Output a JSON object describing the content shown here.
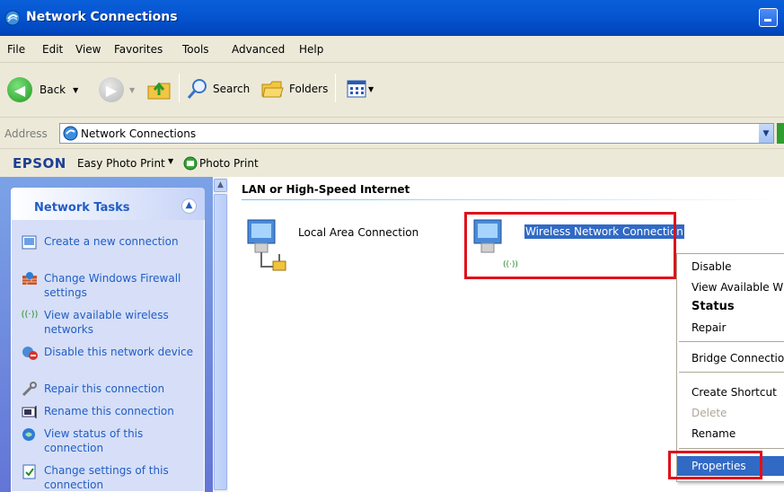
{
  "window": {
    "title": "Network Connections"
  },
  "menu": [
    "File",
    "Edit",
    "View",
    "Favorites",
    "Tools",
    "Advanced",
    "Help"
  ],
  "toolbar": {
    "back": "Back",
    "search": "Search",
    "folders": "Folders"
  },
  "address": {
    "label": "Address",
    "value": "Network Connections"
  },
  "epson": {
    "logo": "EPSON",
    "easy_photo": "Easy Photo Print",
    "photo_print": "Photo Print"
  },
  "task_pane": {
    "title": "Network Tasks",
    "items": [
      {
        "label": "Create a new connection",
        "icon": "new-connection-icon"
      },
      {
        "label": "Change Windows Firewall settings",
        "icon": "firewall-icon"
      },
      {
        "label": "View available wireless networks",
        "icon": "wireless-icon"
      },
      {
        "label": "Disable this network device",
        "icon": "disable-icon"
      },
      {
        "label": "Repair this connection",
        "icon": "repair-icon"
      },
      {
        "label": "Rename this connection",
        "icon": "rename-icon"
      },
      {
        "label": "View status of this connection",
        "icon": "status-icon"
      },
      {
        "label": "Change settings of this connection",
        "icon": "settings-icon"
      }
    ]
  },
  "content": {
    "group_title": "LAN or High-Speed Internet",
    "connections": [
      {
        "label": "Local Area Connection",
        "icon": "lan-icon"
      },
      {
        "label": "Wireless Network Connection",
        "icon": "wireless-connection-icon",
        "selected": true
      }
    ]
  },
  "context_menu": {
    "items": [
      {
        "label": "Disable",
        "bold": false
      },
      {
        "label": "View Available Wireless Networks",
        "bold": false
      },
      {
        "label": "Status",
        "bold": true
      },
      {
        "label": "Repair",
        "bold": false
      },
      {
        "label": "Bridge Connections",
        "bold": false
      },
      {
        "label": "Create Shortcut",
        "bold": false
      },
      {
        "label": "Delete",
        "bold": false,
        "disabled": true
      },
      {
        "label": "Rename",
        "bold": false
      },
      {
        "label": "Properties",
        "bold": false,
        "highlighted": true
      }
    ]
  },
  "colors": {
    "titlebar": "#0a5fd8",
    "task_link": "#215dc6",
    "selection": "#316ac5",
    "highlight_box": "#e0101a"
  }
}
